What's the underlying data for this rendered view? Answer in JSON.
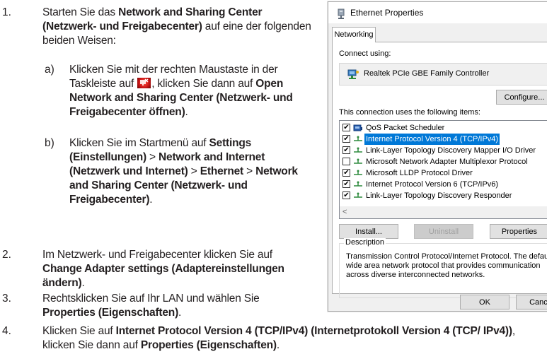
{
  "instructions": {
    "step1": {
      "num": "1.",
      "pre": "Starten Sie das ",
      "bold": "Network and Sharing Center (Netzwerk- und Freigabecenter)",
      "post": " auf eine der folgenden beiden Weisen:",
      "a": {
        "label": "a)",
        "pre": "Klicken Sie mit der rechten Maustaste in der Taskleiste auf ",
        "mid": ", klicken Sie dann auf ",
        "bold": "Open Network and Sharing Center (Netzwerk- und Freigabecenter öffnen)",
        "post": "."
      },
      "b": {
        "label": "b)",
        "pre": "Klicken Sie im Startmenü auf ",
        "bold1": "Settings (Einstellungen)",
        "sep1": " > ",
        "bold2": "Network and Internet (Netzwerk und Internet)",
        "sep2": " > ",
        "bold3": "Ethernet",
        "sep3": " > ",
        "bold4": "Network and Sharing Center (Netzwerk- und Freigabecenter)",
        "post": "."
      }
    },
    "step2": {
      "num": "2.",
      "pre": "Im Netzwerk- und Freigabecenter klicken Sie auf ",
      "bold": "Change Adapter settings (Adaptereinstellungen ändern)",
      "post": "."
    },
    "step3": {
      "num": "3.",
      "pre": "Rechtsklicken Sie auf Ihr LAN und wählen Sie ",
      "bold": "Properties (Eigenschaften)",
      "post": "."
    },
    "step4": {
      "num": "4.",
      "pre": "Klicken Sie auf ",
      "bold1": "Internet Protocol Version 4 (TCP/IPv4) (Internetprotokoll Version 4 (TCP/ IPv4))",
      "mid": ", klicken Sie dann auf ",
      "bold2": "Properties (Eigenschaften)",
      "post": "."
    }
  },
  "dialog": {
    "title": "Ethernet Properties",
    "tab": "Networking",
    "connect_using_label": "Connect using:",
    "adapter_name": "Realtek PCIe GBE Family Controller",
    "configure_button": "Configure...",
    "items_label": "This connection uses the following items:",
    "items": [
      {
        "label": "QoS Packet Scheduler",
        "checked": true,
        "selected": false,
        "icon": "qos-icon"
      },
      {
        "label": "Internet Protocol Version 4 (TCP/IPv4)",
        "checked": true,
        "selected": true,
        "icon": "protocol-icon"
      },
      {
        "label": "Link-Layer Topology Discovery Mapper I/O Driver",
        "checked": true,
        "selected": false,
        "icon": "protocol-icon"
      },
      {
        "label": "Microsoft Network Adapter Multiplexor Protocol",
        "checked": false,
        "selected": false,
        "icon": "protocol-icon"
      },
      {
        "label": "Microsoft LLDP Protocol Driver",
        "checked": true,
        "selected": false,
        "icon": "protocol-icon"
      },
      {
        "label": "Internet Protocol Version 6 (TCP/IPv6)",
        "checked": true,
        "selected": false,
        "icon": "protocol-icon"
      },
      {
        "label": "Link-Layer Topology Discovery Responder",
        "checked": true,
        "selected": false,
        "icon": "protocol-icon"
      }
    ],
    "install_button": "Install...",
    "uninstall_button": "Uninstall",
    "properties_button": "Properties",
    "description_label": "Description",
    "description_text": "Transmission Control Protocol/Internet Protocol. The default wide area network protocol that provides communication across diverse interconnected networks.",
    "ok_button": "OK",
    "cancel_button": "Cance"
  },
  "colors": {
    "selection": "#0078d7",
    "tray_icon": "#d01818"
  }
}
